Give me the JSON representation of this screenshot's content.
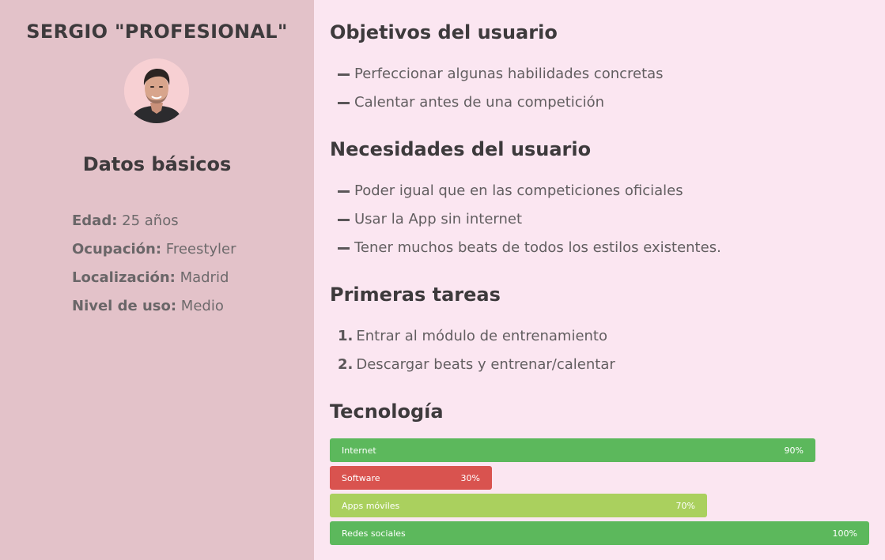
{
  "persona": {
    "name": "SERGIO \"PROFESIONAL\"",
    "avatar_icon": "person-portrait-icon",
    "basic_title": "Datos básicos",
    "basics": [
      {
        "label": "Edad:",
        "value": " 25 años"
      },
      {
        "label": "Ocupación:",
        "value": " Freestyler"
      },
      {
        "label": "Localización:",
        "value": " Madrid"
      },
      {
        "label": "Nivel de uso:",
        "value": " Medio"
      }
    ]
  },
  "goals": {
    "title": "Objetivos del usuario",
    "items": [
      "Perfeccionar algunas habilidades concretas",
      "Calentar antes de una competición"
    ]
  },
  "needs": {
    "title": "Necesidades del usuario",
    "items": [
      "Poder igual que en las competiciones oficiales",
      "Usar la App sin internet",
      "Tener muchos beats de todos los estilos existentes."
    ]
  },
  "tasks": {
    "title": "Primeras tareas",
    "items": [
      {
        "num": "1.",
        "text": "Entrar al módulo de entrenamiento"
      },
      {
        "num": "2.",
        "text": "Descargar beats y entrenar/calentar"
      }
    ]
  },
  "technology": {
    "title": "Tecnología",
    "bars": [
      {
        "label": "Internet",
        "percent_label": "90%",
        "value": 90,
        "color": "#5cb85c"
      },
      {
        "label": "Software",
        "percent_label": "30%",
        "value": 30,
        "color": "#d9534f"
      },
      {
        "label": "Apps móviles",
        "percent_label": "70%",
        "value": 70,
        "color": "#aad05e"
      },
      {
        "label": "Redes sociales",
        "percent_label": "100%",
        "value": 100,
        "color": "#5cb85c"
      }
    ]
  },
  "colors": {
    "sidebar_bg": "#e3c2c9",
    "page_bg": "#fbe6f1",
    "avatar_bg": "#f7d0d3"
  }
}
